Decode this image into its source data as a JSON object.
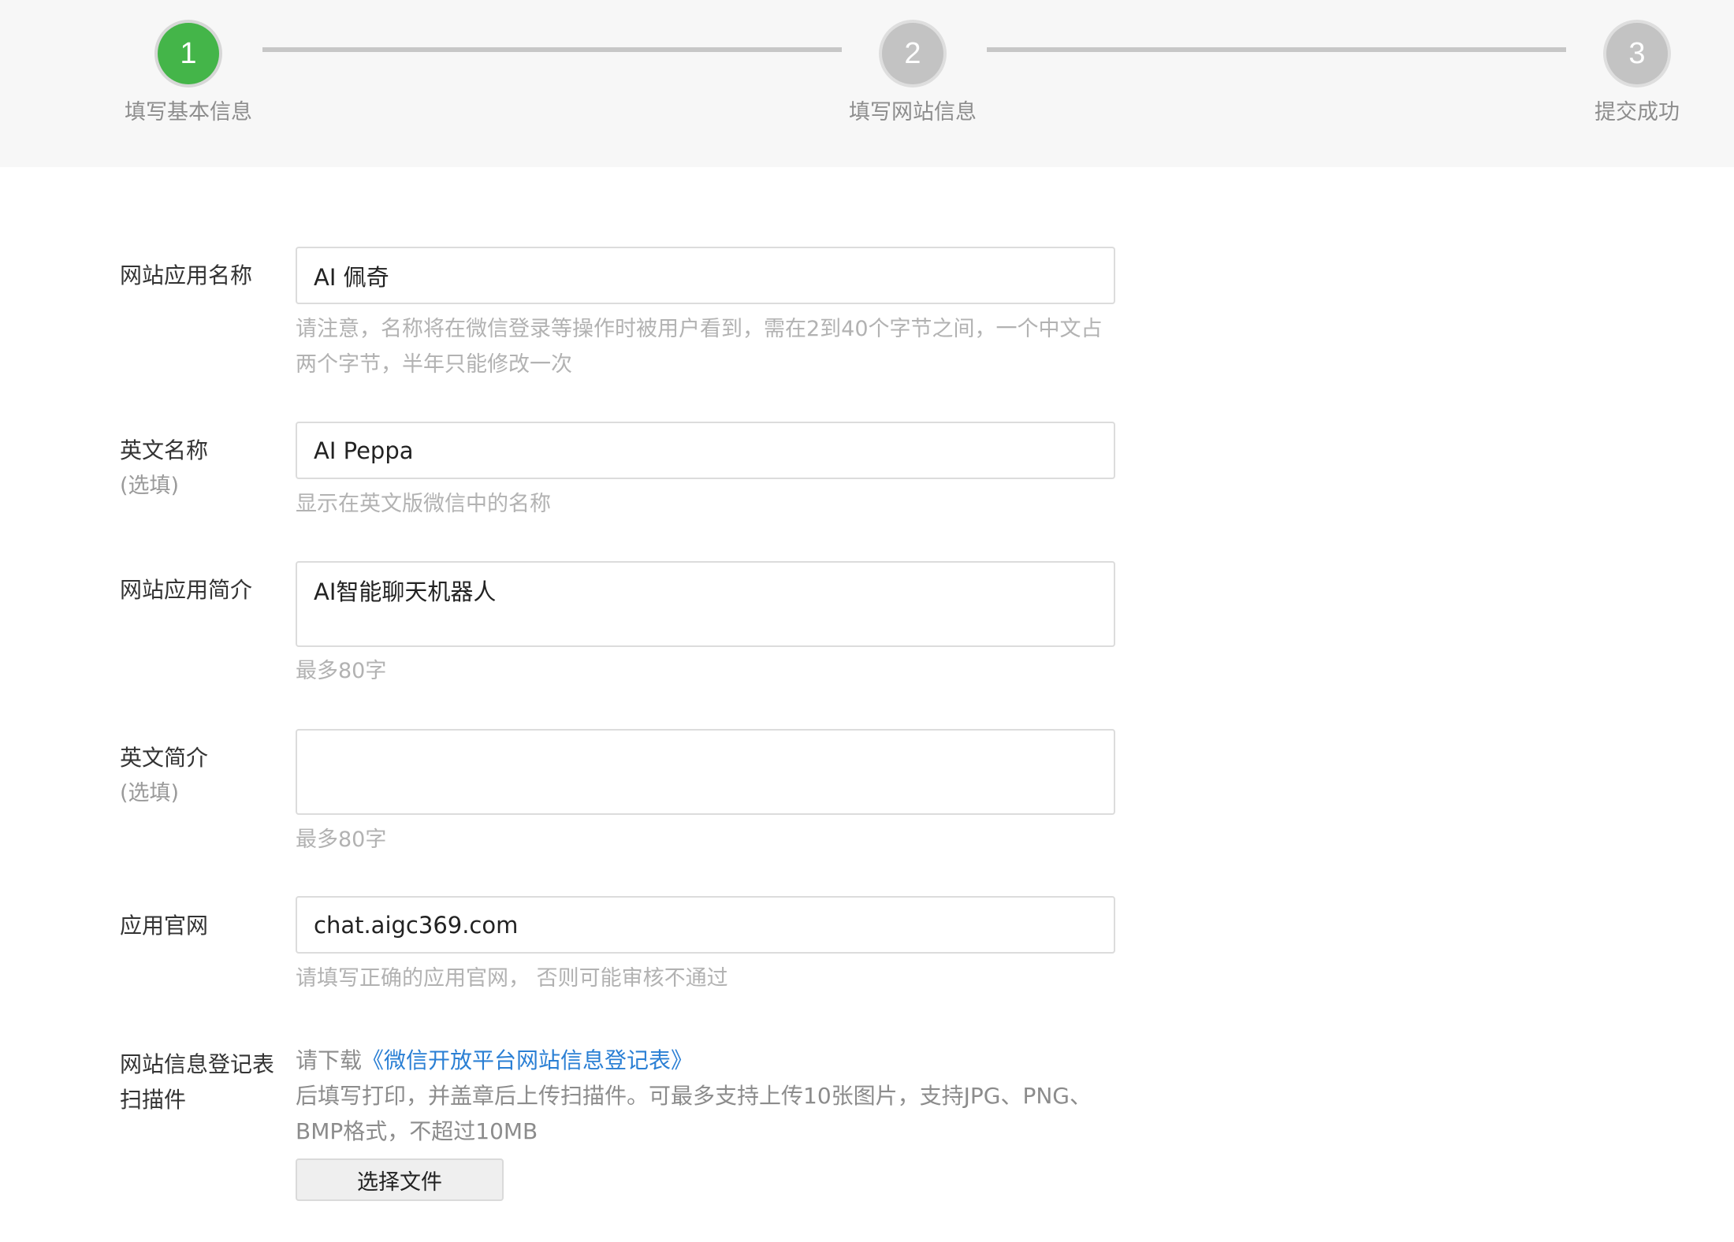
{
  "stepper": {
    "steps": [
      {
        "number": "1",
        "label": "填写基本信息",
        "state": "active"
      },
      {
        "number": "2",
        "label": "填写网站信息",
        "state": "inactive"
      },
      {
        "number": "3",
        "label": "提交成功",
        "state": "inactive"
      }
    ],
    "colors": {
      "active": "#44b549",
      "inactive": "#c3c3c3"
    }
  },
  "form": {
    "app_name": {
      "label": "网站应用名称",
      "value": "AI 佩奇",
      "hint": "请注意，名称将在微信登录等操作时被用户看到，需在2到40个字节之间，一个中文占两个字节，半年只能修改一次"
    },
    "english_name": {
      "label": "英文名称",
      "optional": "(选填)",
      "value": "AI Peppa",
      "hint": "显示在英文版微信中的名称"
    },
    "app_intro": {
      "label": "网站应用简介",
      "value": "AI智能聊天机器人",
      "hint": "最多80字"
    },
    "english_intro": {
      "label": "英文简介",
      "optional": "(选填)",
      "value": "",
      "hint": "最多80字"
    },
    "official_site": {
      "label": "应用官网",
      "value": "chat.aigc369.com",
      "hint": "请填写正确的应用官网， 否则可能审核不通过"
    },
    "registration_form": {
      "label_line1": "网站信息登记表",
      "label_line2": "扫描件",
      "desc_prefix": "请下载",
      "link_text": "《微信开放平台网站信息登记表》",
      "desc_rest": "后填写打印，并盖章后上传扫描件。可最多支持上传10张图片，支持JPG、PNG、BMP格式，不超过10MB",
      "button_label": "选择文件"
    },
    "link_color": "#2a7fd4"
  }
}
